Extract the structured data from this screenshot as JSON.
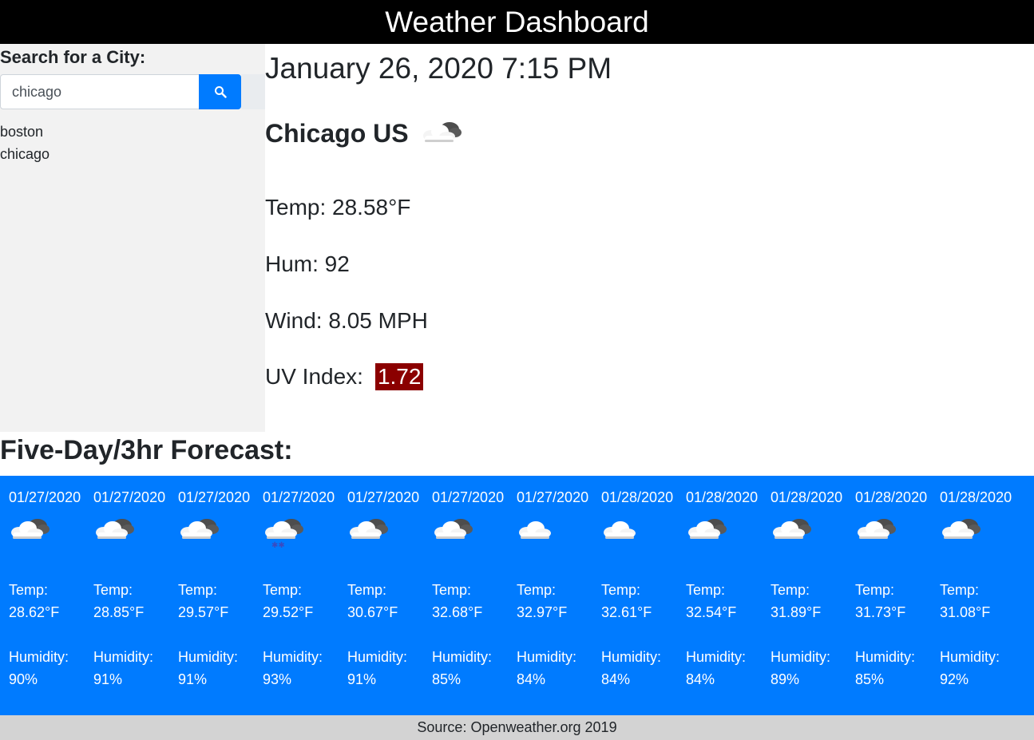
{
  "header": {
    "title": "Weather Dashboard"
  },
  "sidebar": {
    "search_label": "Search for a City:",
    "search_value": "chicago",
    "search_icon": "search-icon",
    "history": [
      "boston",
      "chicago"
    ]
  },
  "current": {
    "datetime": "January 26, 2020 7:15 PM",
    "city": "Chicago US",
    "icon": "partly-cloudy-icon",
    "temp": "Temp: 28.58°F",
    "humidity": "Hum: 92",
    "wind": "Wind: 8.05 MPH",
    "uv_label": "UV Index:",
    "uv_value": "1.72",
    "uv_color": "#8b0000"
  },
  "forecast": {
    "title": "Five-Day/3hr Forecast:",
    "background": "#007bff",
    "temp_label": "Temp:",
    "humidity_label": "Humidity:",
    "items": [
      {
        "date": "01/27/2020",
        "icon": "partly-cloudy-icon",
        "temp": "28.62°F",
        "humidity": "90%"
      },
      {
        "date": "01/27/2020",
        "icon": "partly-cloudy-icon",
        "temp": "28.85°F",
        "humidity": "91%"
      },
      {
        "date": "01/27/2020",
        "icon": "partly-cloudy-icon",
        "temp": "29.57°F",
        "humidity": "91%"
      },
      {
        "date": "01/27/2020",
        "icon": "snow-cloud-icon",
        "temp": "29.52°F",
        "humidity": "93%"
      },
      {
        "date": "01/27/2020",
        "icon": "partly-cloudy-icon",
        "temp": "30.67°F",
        "humidity": "91%"
      },
      {
        "date": "01/27/2020",
        "icon": "partly-cloudy-icon",
        "temp": "32.68°F",
        "humidity": "85%"
      },
      {
        "date": "01/27/2020",
        "icon": "cloud-icon",
        "temp": "32.97°F",
        "humidity": "84%"
      },
      {
        "date": "01/28/2020",
        "icon": "cloud-icon",
        "temp": "32.61°F",
        "humidity": "84%"
      },
      {
        "date": "01/28/2020",
        "icon": "partly-cloudy-icon",
        "temp": "32.54°F",
        "humidity": "84%"
      },
      {
        "date": "01/28/2020",
        "icon": "partly-cloudy-icon",
        "temp": "31.89°F",
        "humidity": "89%"
      },
      {
        "date": "01/28/2020",
        "icon": "partly-cloudy-icon",
        "temp": "31.73°F",
        "humidity": "85%"
      },
      {
        "date": "01/28/2020",
        "icon": "partly-cloudy-icon",
        "temp": "31.08°F",
        "humidity": "92%"
      }
    ]
  },
  "footer": {
    "source": "Source: Openweather.org 2019"
  }
}
